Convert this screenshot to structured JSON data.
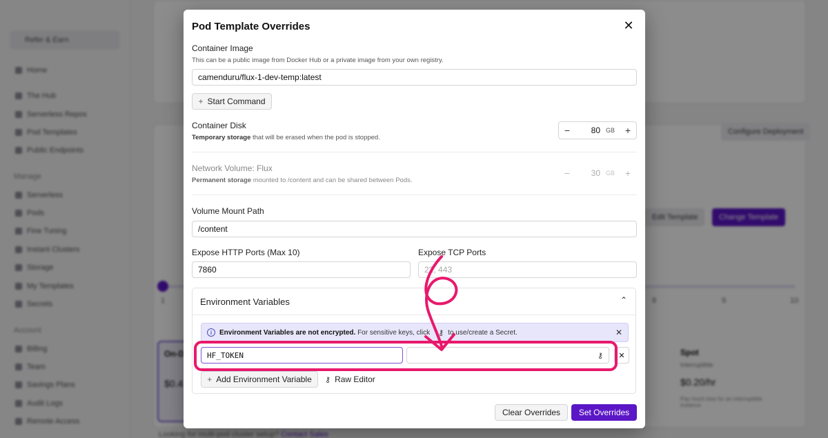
{
  "background": {
    "sidebar": {
      "refer": "Refer & Earn",
      "items": [
        "Home",
        "The Hub",
        "Serverless Repos",
        "Pod Templates",
        "Public Endpoints"
      ],
      "manage_label": "Manage",
      "manage_items": [
        "Serverless",
        "Pods",
        "Fine Tuning",
        "Instant Clusters",
        "Storage",
        "My Templates",
        "Secrets"
      ],
      "account_label": "Account",
      "account_items": [
        "Billing",
        "Team",
        "Savings Plans",
        "Audit Logs",
        "Remote Access"
      ]
    },
    "configure_button": "Configure Deployment",
    "edit_template_button": "Edit Template",
    "change_template_button": "Change Template",
    "slider_ticks": [
      "1",
      "8",
      "9",
      "10"
    ],
    "spot": {
      "title": "Spot",
      "subtitle": "Interruptible",
      "price": "$0.20/hr",
      "note": "Pay much less for an interruptible instance"
    },
    "on_demand": {
      "title": "On-D",
      "price": "$0.4"
    },
    "footer_text": "Looking for multi-pod cluster setup?",
    "footer_link": "Contact Sales"
  },
  "modal": {
    "title": "Pod Template Overrides",
    "container_image": {
      "label": "Container Image",
      "hint": "This can be a public image from Docker Hub or a private image from your own registry.",
      "value": "camenduru/flux-1-dev-temp:latest"
    },
    "start_command_button": "Start Command",
    "container_disk": {
      "label": "Container Disk",
      "hint_bold": "Temporary storage",
      "hint_rest": " that will be erased when the pod is stopped.",
      "value": "80",
      "unit": "GB"
    },
    "network_volume": {
      "label": "Network Volume: Flux",
      "hint_bold": "Permanent storage",
      "hint_rest": " mounted to /content and can be shared between Pods.",
      "value": "30",
      "unit": "GB"
    },
    "volume_mount": {
      "label": "Volume Mount Path",
      "value": "/content"
    },
    "http_ports": {
      "label": "Expose HTTP Ports (Max 10)",
      "value": "7860"
    },
    "tcp_ports": {
      "label": "Expose TCP Ports",
      "placeholder": "22, 443"
    },
    "env": {
      "title": "Environment Variables",
      "alert_bold": "Environment Variables are not encrypted.",
      "alert_rest": " For sensitive keys, click",
      "alert_tail": "to use/create a Secret.",
      "key_value": "HF_TOKEN",
      "value_value": "",
      "add_button": "Add Environment Variable",
      "raw_editor_button": "Raw Editor"
    },
    "clear_button": "Clear Overrides",
    "set_button": "Set Overrides"
  },
  "annotation": {
    "color": "#e8196c",
    "icons": [
      "highlight-rectangle",
      "curved-arrow"
    ]
  },
  "colors": {
    "primary": "#5b17c6",
    "alert_bg": "#e8e6fb",
    "annotation": "#e8196c"
  }
}
